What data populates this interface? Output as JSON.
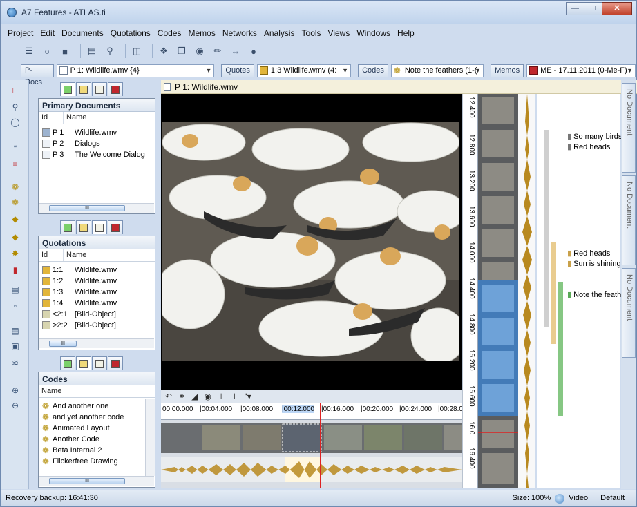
{
  "window": {
    "title": "A7 Features - ATLAS.ti",
    "controls": [
      "minimize",
      "maximize",
      "close"
    ]
  },
  "menu": [
    "Project",
    "Edit",
    "Documents",
    "Quotations",
    "Codes",
    "Memos",
    "Networks",
    "Analysis",
    "Tools",
    "Views",
    "Windows",
    "Help"
  ],
  "manager_bar": {
    "pdocs_label": "P-Docs",
    "pdocs_value": "P 1: Wildlife.wmv {4}",
    "quotes_label": "Quotes",
    "quotes_value": "1:3 Wildlife.wmv (4:",
    "codes_label": "Codes",
    "codes_value": "Note the feathers (1-(",
    "memos_label": "Memos",
    "memos_value": "ME - 17.11.2011 (0-Me-F) -"
  },
  "primary_docs": {
    "title": "Primary Documents",
    "columns": [
      "Id",
      "Name"
    ],
    "rows": [
      {
        "id": "P 1",
        "name": "Wildlife.wmv"
      },
      {
        "id": "P 2",
        "name": "Dialogs"
      },
      {
        "id": "P 3",
        "name": "The Welcome Dialog"
      }
    ],
    "scroll_mark": "III"
  },
  "quotations": {
    "title": "Quotations",
    "columns": [
      "Id",
      "Name"
    ],
    "rows": [
      {
        "id": "1:1",
        "name": "Wildlife.wmv"
      },
      {
        "id": "1:2",
        "name": "Wildlife.wmv"
      },
      {
        "id": "1:3",
        "name": "Wildlife.wmv"
      },
      {
        "id": "1:4",
        "name": "Wildlife.wmv"
      },
      {
        "id": "<2:1",
        "name": "[Bild-Object]"
      },
      {
        "id": ">2:2",
        "name": "[Bild-Object]"
      }
    ],
    "scroll_mark": "III"
  },
  "codes": {
    "title": "Codes",
    "column": "Name",
    "items": [
      "And another one",
      "and yet another code",
      "Animated Layout",
      "Another Code",
      "Beta Internal 2",
      "Flickerfree Drawing"
    ],
    "scroll_mark": "III"
  },
  "document": {
    "header": "P 1: Wildlife.wmv"
  },
  "timeline": {
    "ticks": [
      "00:00.000",
      "|00:04.000",
      "|00:08.000",
      "|00:12.000",
      "|00:16.000",
      "|00:20.000",
      "|00:24.000",
      "|00:28.0"
    ]
  },
  "vertical_ruler": {
    "ticks": [
      "12.400",
      "12.800",
      "13.200",
      "13.600",
      "14.000",
      "14.400",
      "14.800",
      "15.200",
      "15.600",
      "16.0",
      "16.400"
    ]
  },
  "margin": {
    "labels": [
      "So many birds",
      "Red heads",
      "Red heads",
      "Sun is shining",
      "Note the feath"
    ],
    "colors": {
      "gray": "#c8c8c8",
      "tan": "#e6c98a",
      "green": "#7cc47a"
    }
  },
  "right_tabs": [
    "No Document",
    "No Document",
    "No Document"
  ],
  "status": {
    "left": "Recovery backup: 16:41:30",
    "size": "Size: 100%",
    "mode": "Video",
    "layout": "Default"
  }
}
